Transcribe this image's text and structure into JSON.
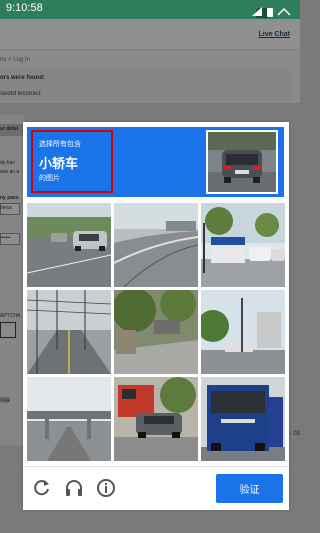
{
  "status_bar": {
    "time": "9:10:58"
  },
  "page": {
    "live_chat": "Live Chat",
    "breadcrumb": {
      "prefix": "ns",
      "separator": " > ",
      "current": "Log In"
    },
    "errors": {
      "heading": "ors were found:",
      "message": "sword incorrect"
    },
    "fragments": [
      {
        "text": "ur detai"
      },
      {
        "text": "dy hav"
      },
      {
        "text": "ave an a"
      },
      {
        "text": "ny pass"
      },
      {
        "text": "oteyx"
      },
      {
        "text": "••••••"
      },
      {
        "text": "APTCHA"
      },
      {
        "text": " YOU D"
      },
      {
        "text": "网联"
      }
    ],
    "right_fragment": "- 03"
  },
  "captcha": {
    "instruction_line1": "选择所有包含",
    "target_object": "小轿车",
    "instruction_line3": "的图片",
    "verify_label": "验证",
    "accent_color": "#1a73e8",
    "highlight_color": "#d50000",
    "sample_image": "red-car-rear-on-street",
    "tiles": [
      {
        "image": "street-with-silver-car"
      },
      {
        "image": "highway-curve"
      },
      {
        "image": "street-with-trucks-and-trees"
      },
      {
        "image": "power-lines-road"
      },
      {
        "image": "street-with-trees"
      },
      {
        "image": "road-with-trees-and-buildings"
      },
      {
        "image": "overpass-bridge"
      },
      {
        "image": "street-with-red-truck-and-car"
      },
      {
        "image": "blue-truck"
      }
    ],
    "footer_icons": [
      "reload-icon",
      "audio-icon",
      "info-icon"
    ]
  }
}
